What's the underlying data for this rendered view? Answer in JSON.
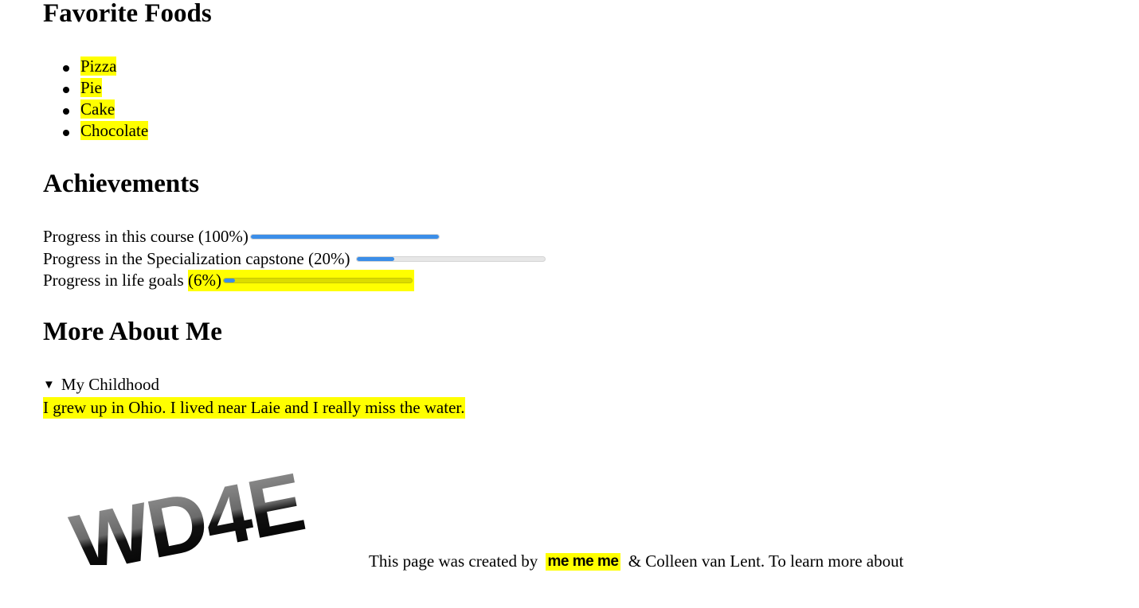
{
  "favorite_foods": {
    "heading": "Favorite Foods",
    "items": [
      "Pizza",
      "Pie",
      "Cake",
      "Chocolate"
    ]
  },
  "achievements": {
    "heading": "Achievements",
    "progress": [
      {
        "label": "Progress in this course",
        "percent_text": "(100%)",
        "value": 1.0
      },
      {
        "label": "Progress in the Specialization capstone",
        "percent_text": "(20%)",
        "value": 0.2
      },
      {
        "label": "Progress in life goals",
        "percent_text": "(6%)",
        "value": 0.06
      }
    ]
  },
  "more_about_me": {
    "heading": "More About Me",
    "details_summary": "My Childhood",
    "details_text": "I grew up in Ohio. I lived near Laie and I really miss the water."
  },
  "logo": {
    "text": "WD4E"
  },
  "footer": {
    "prefix": "This page was created by",
    "author": "me me me",
    "suffix": "& Colleen van Lent. To learn more about"
  },
  "colors": {
    "highlight": "#ffff00",
    "progress_fill": "#3b8ee8",
    "progress_track": "#e7e7e7"
  }
}
